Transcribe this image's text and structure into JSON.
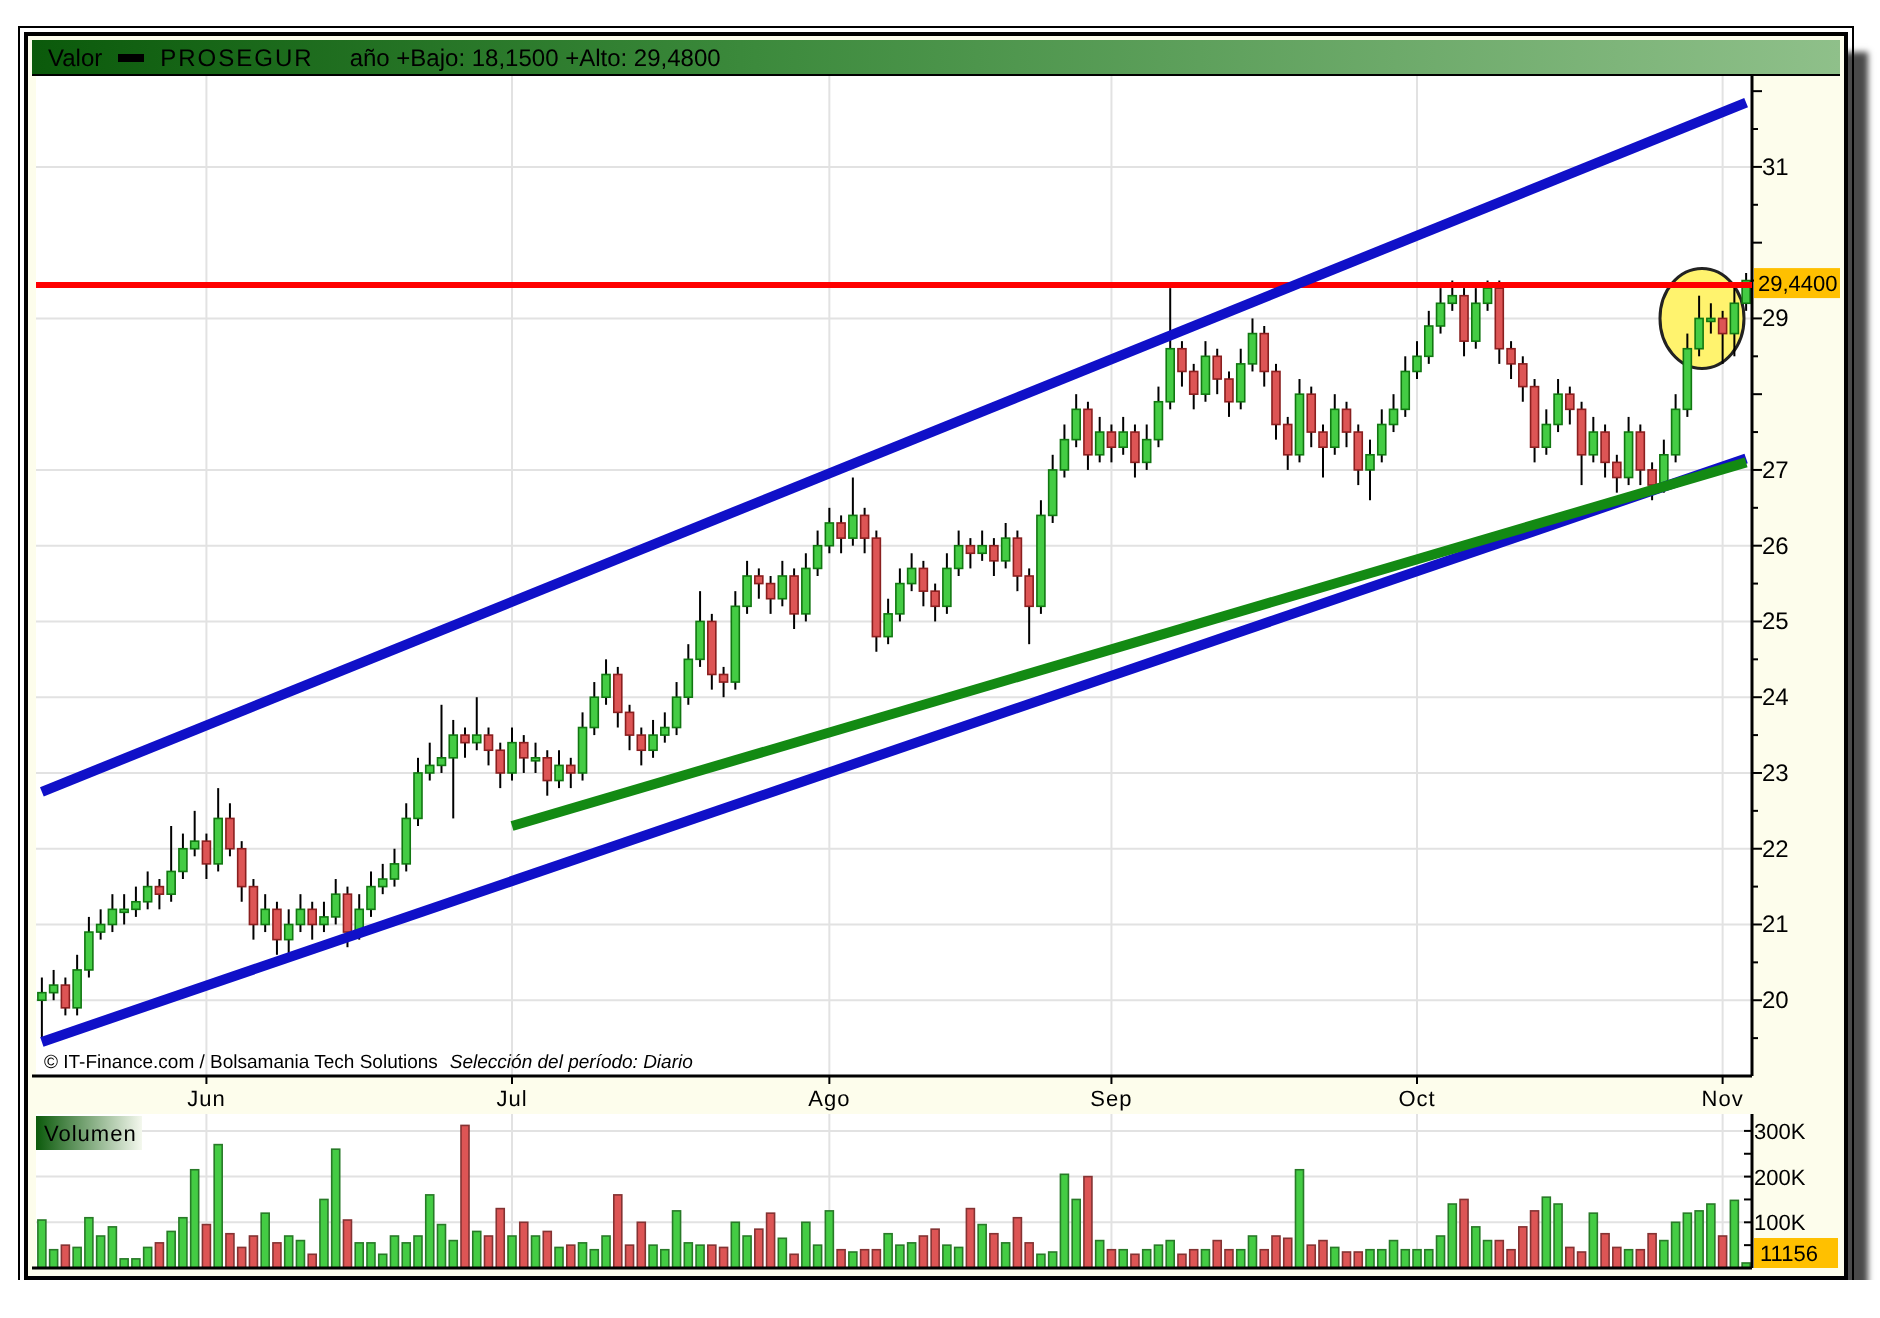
{
  "header": {
    "label": "Valor",
    "symbol": "PROSEGUR",
    "range": "año +Bajo: 18,1500 +Alto: 29,4800"
  },
  "price_panel": {
    "credit": "© IT-Finance.com / Bolsamania Tech Solutions",
    "period": "Selección del período: Diario",
    "price_tag": "29,4400",
    "chart_data": {
      "type": "candlestick",
      "grid": true,
      "ylim": [
        19.0,
        32.2
      ],
      "yticks": [
        20,
        21,
        22,
        23,
        24,
        25,
        26,
        27,
        29,
        31
      ],
      "categories": [
        null,
        null,
        null,
        null,
        null,
        null,
        null,
        null,
        null,
        null,
        null,
        null,
        null,
        null,
        "Jun",
        null,
        null,
        null,
        null,
        null,
        null,
        null,
        null,
        null,
        null,
        null,
        null,
        null,
        null,
        null,
        null,
        null,
        null,
        null,
        null,
        null,
        null,
        null,
        null,
        null,
        "Jul",
        null,
        null,
        null,
        null,
        null,
        null,
        null,
        null,
        null,
        null,
        null,
        null,
        null,
        null,
        null,
        null,
        null,
        null,
        null,
        null,
        null,
        null,
        null,
        null,
        null,
        null,
        "Ago",
        null,
        null,
        null,
        null,
        null,
        null,
        null,
        null,
        null,
        null,
        null,
        null,
        null,
        null,
        null,
        null,
        null,
        null,
        null,
        null,
        null,
        null,
        null,
        "Sep",
        null,
        null,
        null,
        null,
        null,
        null,
        null,
        null,
        null,
        null,
        null,
        null,
        null,
        null,
        null,
        null,
        null,
        null,
        null,
        null,
        null,
        null,
        null,
        null,
        null,
        "Oct",
        null,
        null,
        null,
        null,
        null,
        null,
        null,
        null,
        null,
        null,
        null,
        null,
        null,
        null,
        null,
        null,
        null,
        null,
        null,
        null,
        null,
        null,
        null,
        null,
        null,
        "Nov",
        null,
        null
      ],
      "ohlc": [
        [
          20.0,
          20.3,
          19.5,
          20.1
        ],
        [
          20.1,
          20.4,
          20.0,
          20.2
        ],
        [
          20.2,
          20.3,
          19.8,
          19.9
        ],
        [
          19.9,
          20.6,
          19.8,
          20.4
        ],
        [
          20.4,
          21.1,
          20.3,
          20.9
        ],
        [
          20.9,
          21.2,
          20.8,
          21.0
        ],
        [
          21.0,
          21.4,
          20.9,
          21.2
        ],
        [
          21.2,
          21.4,
          21.0,
          21.2
        ],
        [
          21.2,
          21.5,
          21.1,
          21.3
        ],
        [
          21.3,
          21.7,
          21.2,
          21.5
        ],
        [
          21.5,
          21.6,
          21.2,
          21.4
        ],
        [
          21.4,
          22.3,
          21.3,
          21.7
        ],
        [
          21.7,
          22.2,
          21.6,
          22.0
        ],
        [
          22.0,
          22.5,
          21.9,
          22.1
        ],
        [
          22.1,
          22.2,
          21.6,
          21.8
        ],
        [
          21.8,
          22.8,
          21.7,
          22.4
        ],
        [
          22.4,
          22.6,
          21.9,
          22.0
        ],
        [
          22.0,
          22.1,
          21.3,
          21.5
        ],
        [
          21.5,
          21.6,
          20.8,
          21.0
        ],
        [
          21.0,
          21.4,
          20.9,
          21.2
        ],
        [
          21.2,
          21.3,
          20.6,
          20.8
        ],
        [
          20.8,
          21.2,
          20.6,
          21.0
        ],
        [
          21.0,
          21.4,
          20.9,
          21.2
        ],
        [
          21.2,
          21.3,
          20.8,
          21.0
        ],
        [
          21.0,
          21.3,
          20.9,
          21.1
        ],
        [
          21.1,
          21.6,
          21.0,
          21.4
        ],
        [
          21.4,
          21.5,
          20.7,
          20.9
        ],
        [
          20.9,
          21.4,
          20.8,
          21.2
        ],
        [
          21.2,
          21.7,
          21.1,
          21.5
        ],
        [
          21.5,
          21.8,
          21.4,
          21.6
        ],
        [
          21.6,
          22.0,
          21.5,
          21.8
        ],
        [
          21.8,
          22.6,
          21.7,
          22.4
        ],
        [
          22.4,
          23.2,
          22.3,
          23.0
        ],
        [
          23.0,
          23.4,
          22.9,
          23.1
        ],
        [
          23.1,
          23.9,
          23.0,
          23.2
        ],
        [
          23.2,
          23.7,
          22.4,
          23.5
        ],
        [
          23.5,
          23.6,
          23.2,
          23.4
        ],
        [
          23.4,
          24.0,
          23.3,
          23.5
        ],
        [
          23.5,
          23.6,
          23.1,
          23.3
        ],
        [
          23.3,
          23.4,
          22.8,
          23.0
        ],
        [
          23.0,
          23.6,
          22.9,
          23.4
        ],
        [
          23.4,
          23.5,
          23.0,
          23.2
        ],
        [
          23.2,
          23.4,
          23.0,
          23.2
        ],
        [
          23.2,
          23.3,
          22.7,
          22.9
        ],
        [
          22.9,
          23.3,
          22.8,
          23.1
        ],
        [
          23.1,
          23.2,
          22.8,
          23.0
        ],
        [
          23.0,
          23.8,
          22.9,
          23.6
        ],
        [
          23.6,
          24.2,
          23.5,
          24.0
        ],
        [
          24.0,
          24.5,
          23.9,
          24.3
        ],
        [
          24.3,
          24.4,
          23.6,
          23.8
        ],
        [
          23.8,
          23.9,
          23.3,
          23.5
        ],
        [
          23.5,
          23.6,
          23.1,
          23.3
        ],
        [
          23.3,
          23.7,
          23.2,
          23.5
        ],
        [
          23.5,
          23.8,
          23.4,
          23.6
        ],
        [
          23.6,
          24.2,
          23.5,
          24.0
        ],
        [
          24.0,
          24.7,
          23.9,
          24.5
        ],
        [
          24.5,
          25.4,
          24.4,
          25.0
        ],
        [
          25.0,
          25.1,
          24.1,
          24.3
        ],
        [
          24.3,
          24.4,
          24.0,
          24.2
        ],
        [
          24.2,
          25.4,
          24.1,
          25.2
        ],
        [
          25.2,
          25.8,
          25.1,
          25.6
        ],
        [
          25.6,
          25.7,
          25.3,
          25.5
        ],
        [
          25.5,
          25.6,
          25.1,
          25.3
        ],
        [
          25.3,
          25.8,
          25.2,
          25.6
        ],
        [
          25.6,
          25.7,
          24.9,
          25.1
        ],
        [
          25.1,
          25.9,
          25.0,
          25.7
        ],
        [
          25.7,
          26.2,
          25.6,
          26.0
        ],
        [
          26.0,
          26.5,
          25.9,
          26.3
        ],
        [
          26.3,
          26.4,
          25.9,
          26.1
        ],
        [
          26.1,
          26.9,
          26.0,
          26.4
        ],
        [
          26.4,
          26.5,
          25.9,
          26.1
        ],
        [
          26.1,
          26.2,
          24.6,
          24.8
        ],
        [
          24.8,
          25.3,
          24.7,
          25.1
        ],
        [
          25.1,
          25.7,
          25.0,
          25.5
        ],
        [
          25.5,
          25.9,
          25.4,
          25.7
        ],
        [
          25.7,
          25.8,
          25.2,
          25.4
        ],
        [
          25.4,
          25.5,
          25.0,
          25.2
        ],
        [
          25.2,
          25.9,
          25.1,
          25.7
        ],
        [
          25.7,
          26.2,
          25.6,
          26.0
        ],
        [
          26.0,
          26.1,
          25.7,
          25.9
        ],
        [
          25.9,
          26.2,
          25.8,
          26.0
        ],
        [
          26.0,
          26.1,
          25.6,
          25.8
        ],
        [
          25.8,
          26.3,
          25.7,
          26.1
        ],
        [
          26.1,
          26.2,
          25.4,
          25.6
        ],
        [
          25.6,
          25.7,
          24.7,
          25.2
        ],
        [
          25.2,
          26.6,
          25.1,
          26.4
        ],
        [
          26.4,
          27.2,
          26.3,
          27.0
        ],
        [
          27.0,
          27.6,
          26.9,
          27.4
        ],
        [
          27.4,
          28.0,
          27.3,
          27.8
        ],
        [
          27.8,
          27.9,
          27.0,
          27.2
        ],
        [
          27.2,
          27.7,
          27.1,
          27.5
        ],
        [
          27.5,
          27.6,
          27.1,
          27.3
        ],
        [
          27.3,
          27.7,
          27.2,
          27.5
        ],
        [
          27.5,
          27.6,
          26.9,
          27.1
        ],
        [
          27.1,
          27.6,
          27.0,
          27.4
        ],
        [
          27.4,
          28.1,
          27.3,
          27.9
        ],
        [
          27.9,
          29.4,
          27.8,
          28.6
        ],
        [
          28.6,
          28.7,
          28.1,
          28.3
        ],
        [
          28.3,
          28.4,
          27.8,
          28.0
        ],
        [
          28.0,
          28.7,
          27.9,
          28.5
        ],
        [
          28.5,
          28.6,
          28.0,
          28.2
        ],
        [
          28.2,
          28.3,
          27.7,
          27.9
        ],
        [
          27.9,
          28.6,
          27.8,
          28.4
        ],
        [
          28.4,
          29.0,
          28.3,
          28.8
        ],
        [
          28.8,
          28.9,
          28.1,
          28.3
        ],
        [
          28.3,
          28.4,
          27.4,
          27.6
        ],
        [
          27.6,
          27.7,
          27.0,
          27.2
        ],
        [
          27.2,
          28.2,
          27.1,
          28.0
        ],
        [
          28.0,
          28.1,
          27.3,
          27.5
        ],
        [
          27.5,
          27.6,
          26.9,
          27.3
        ],
        [
          27.3,
          28.0,
          27.2,
          27.8
        ],
        [
          27.8,
          27.9,
          27.3,
          27.5
        ],
        [
          27.5,
          27.6,
          26.8,
          27.0
        ],
        [
          27.0,
          27.4,
          26.6,
          27.2
        ],
        [
          27.2,
          27.8,
          27.1,
          27.6
        ],
        [
          27.6,
          28.0,
          27.5,
          27.8
        ],
        [
          27.8,
          28.5,
          27.7,
          28.3
        ],
        [
          28.3,
          28.7,
          28.2,
          28.5
        ],
        [
          28.5,
          29.1,
          28.4,
          28.9
        ],
        [
          28.9,
          29.4,
          28.8,
          29.2
        ],
        [
          29.2,
          29.5,
          29.1,
          29.3
        ],
        [
          29.3,
          29.4,
          28.5,
          28.7
        ],
        [
          28.7,
          29.4,
          28.6,
          29.2
        ],
        [
          29.2,
          29.5,
          29.1,
          29.4
        ],
        [
          29.4,
          29.5,
          28.4,
          28.6
        ],
        [
          28.6,
          28.7,
          28.2,
          28.4
        ],
        [
          28.4,
          28.5,
          27.9,
          28.1
        ],
        [
          28.1,
          28.2,
          27.1,
          27.3
        ],
        [
          27.3,
          27.8,
          27.2,
          27.6
        ],
        [
          27.6,
          28.2,
          27.5,
          28.0
        ],
        [
          28.0,
          28.1,
          27.6,
          27.8
        ],
        [
          27.8,
          27.9,
          26.8,
          27.2
        ],
        [
          27.2,
          27.7,
          27.1,
          27.5
        ],
        [
          27.5,
          27.6,
          26.9,
          27.1
        ],
        [
          27.1,
          27.2,
          26.7,
          26.9
        ],
        [
          26.9,
          27.7,
          26.8,
          27.5
        ],
        [
          27.5,
          27.6,
          26.8,
          27.0
        ],
        [
          27.0,
          27.1,
          26.6,
          26.8
        ],
        [
          26.8,
          27.4,
          26.7,
          27.2
        ],
        [
          27.2,
          28.0,
          27.1,
          27.8
        ],
        [
          27.8,
          28.8,
          27.7,
          28.6
        ],
        [
          28.6,
          29.3,
          28.5,
          29.0
        ],
        [
          29.0,
          29.2,
          28.8,
          29.0
        ],
        [
          29.0,
          29.1,
          28.4,
          28.8
        ],
        [
          28.8,
          29.4,
          28.5,
          29.2
        ],
        [
          29.2,
          29.6,
          29.1,
          29.5
        ]
      ]
    }
  },
  "volume_panel": {
    "last_tag": "11156",
    "chart_data": {
      "type": "bar",
      "grid": true,
      "ylim": [
        0,
        337
      ],
      "yticks": [
        {
          "value": 100,
          "label": "100K"
        },
        {
          "value": 200,
          "label": "200K"
        },
        {
          "value": 300,
          "label": "300K"
        }
      ],
      "categories": [
        null,
        null,
        null,
        null,
        null,
        null,
        null,
        null,
        null,
        null,
        null,
        null,
        null,
        null,
        null,
        null,
        null,
        null,
        null,
        null,
        null,
        null,
        null,
        null,
        null,
        null,
        null,
        null,
        null,
        null,
        null,
        null,
        null,
        null,
        null,
        null,
        null,
        null,
        null,
        null,
        null,
        null,
        null,
        null,
        null,
        null,
        null,
        null,
        null,
        null,
        null,
        null,
        null,
        null,
        null,
        null,
        null,
        null,
        null,
        null,
        null,
        null,
        null,
        null,
        null,
        null,
        null,
        null,
        null,
        null,
        null,
        null,
        null,
        null,
        null,
        null,
        null,
        null,
        null,
        null,
        null,
        null,
        null,
        null,
        null,
        null,
        null,
        null,
        null,
        null,
        null,
        null,
        null,
        null,
        null,
        null,
        null,
        null,
        null,
        null,
        null,
        null,
        null,
        null,
        null,
        null,
        null,
        null,
        null,
        null,
        null,
        null,
        null,
        null,
        null,
        null,
        null,
        null,
        null,
        null,
        null,
        null,
        null,
        null,
        null,
        null,
        null,
        null,
        null,
        null,
        null,
        null,
        null,
        null,
        null,
        null,
        null,
        null,
        null,
        null,
        null,
        null,
        null,
        null,
        null,
        null
      ],
      "series": [
        {
          "name": "Volumen",
          "color": "#44cc44",
          "values": [
            105,
            40,
            null,
            45,
            110,
            70,
            90,
            20,
            20,
            45,
            null,
            80,
            110,
            215,
            null,
            270,
            null,
            null,
            null,
            120,
            null,
            70,
            60,
            null,
            150,
            260,
            null,
            55,
            55,
            30,
            70,
            55,
            70,
            160,
            95,
            60,
            null,
            80,
            null,
            null,
            70,
            null,
            70,
            null,
            45,
            null,
            55,
            40,
            70,
            null,
            null,
            null,
            50,
            40,
            125,
            55,
            50,
            null,
            null,
            100,
            70,
            null,
            null,
            65,
            null,
            100,
            50,
            125,
            null,
            35,
            null,
            null,
            75,
            50,
            55,
            null,
            null,
            50,
            45,
            null,
            95,
            null,
            55,
            null,
            null,
            30,
            35,
            205,
            150,
            null,
            60,
            null,
            40,
            null,
            40,
            50,
            60,
            null,
            null,
            40,
            null,
            null,
            40,
            70,
            null,
            null,
            null,
            215,
            null,
            null,
            45,
            null,
            null,
            40,
            40,
            60,
            40,
            40,
            40,
            70,
            140,
            null,
            90,
            60,
            null,
            null,
            null,
            null,
            155,
            140,
            null,
            null,
            120,
            null,
            null,
            40,
            null,
            null,
            60,
            100,
            120,
            125,
            140,
            null,
            148,
            11
          ]
        },
        {
          "color": "#dd5555",
          "values": [
            null,
            null,
            50,
            null,
            null,
            null,
            null,
            null,
            null,
            null,
            55,
            null,
            null,
            null,
            95,
            null,
            75,
            45,
            70,
            null,
            55,
            null,
            null,
            30,
            null,
            null,
            105,
            null,
            null,
            null,
            null,
            null,
            null,
            null,
            null,
            null,
            312,
            null,
            70,
            130,
            null,
            100,
            null,
            80,
            null,
            50,
            null,
            null,
            null,
            160,
            50,
            100,
            null,
            null,
            null,
            null,
            null,
            50,
            45,
            null,
            null,
            85,
            120,
            null,
            30,
            null,
            null,
            null,
            40,
            null,
            40,
            40,
            null,
            null,
            null,
            70,
            85,
            null,
            null,
            130,
            null,
            75,
            null,
            110,
            55,
            null,
            null,
            null,
            null,
            200,
            null,
            40,
            null,
            30,
            null,
            null,
            null,
            30,
            40,
            null,
            60,
            40,
            null,
            null,
            40,
            70,
            65,
            null,
            50,
            60,
            null,
            35,
            35,
            null,
            null,
            null,
            null,
            null,
            null,
            null,
            null,
            150,
            null,
            null,
            60,
            40,
            90,
            125,
            null,
            null,
            45,
            35,
            null,
            75,
            45,
            null,
            40,
            75,
            null,
            null,
            null,
            null,
            null,
            70,
            null,
            null
          ]
        }
      ]
    }
  }
}
